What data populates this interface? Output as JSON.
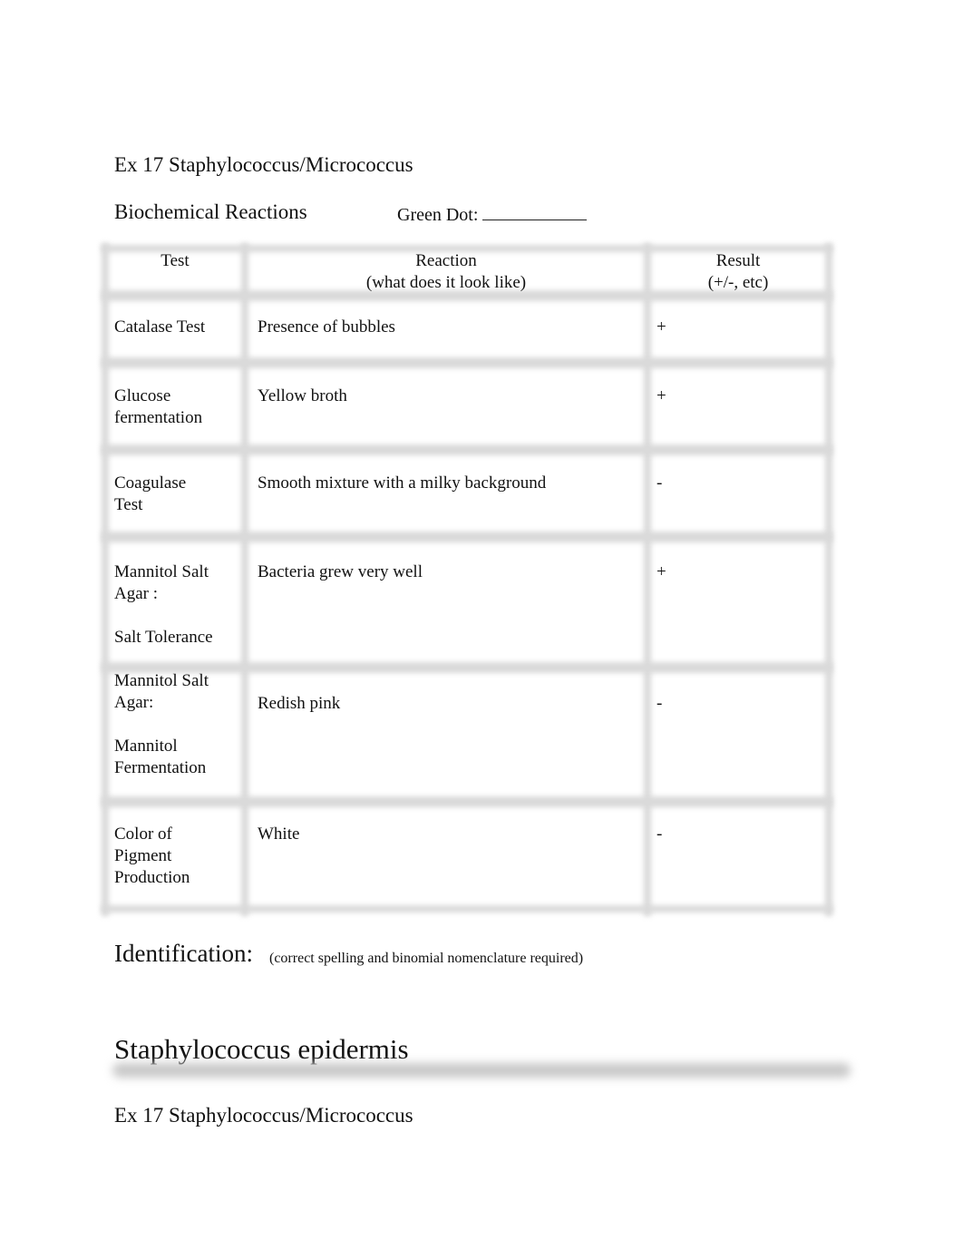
{
  "header": {
    "exercise": "Ex 17  Staphylococcus/Micrococcus",
    "section": "Biochemical Reactions",
    "green_dot_label": "Green Dot:"
  },
  "table": {
    "columns": [
      {
        "line1": "Test",
        "line2": ""
      },
      {
        "line1": "Reaction",
        "line2": "(what does it look like)"
      },
      {
        "line1": "Result",
        "line2": "(+/-, etc)"
      }
    ],
    "rows": [
      {
        "test": [
          "Catalase Test"
        ],
        "reaction": "Presence of bubbles",
        "result": "+"
      },
      {
        "test": [
          "Glucose",
          "fermentation"
        ],
        "reaction": "Yellow broth",
        "result": "+"
      },
      {
        "test": [
          "Coagulase",
          "Test"
        ],
        "reaction": "Smooth mixture with a milky background",
        "result": "-"
      },
      {
        "test": [
          "Mannitol Salt",
          "Agar :",
          "",
          "Salt Tolerance"
        ],
        "reaction": "Bacteria grew very well",
        "result": "+"
      },
      {
        "test": [
          "Mannitol Salt",
          "Agar:",
          "",
          "Mannitol",
          "Fermentation"
        ],
        "reaction": "Redish pink",
        "result": "-"
      },
      {
        "test": [
          "Color of",
          "Pigment",
          "Production"
        ],
        "reaction": "White",
        "result": "-"
      }
    ]
  },
  "identification": {
    "label": "Identification:",
    "hint": "(correct spelling and binomial nomenclature required)",
    "answer": "Staphylococcus epidermis"
  },
  "footer": {
    "exercise": "Ex 17  Staphylococcus/Micrococcus"
  }
}
